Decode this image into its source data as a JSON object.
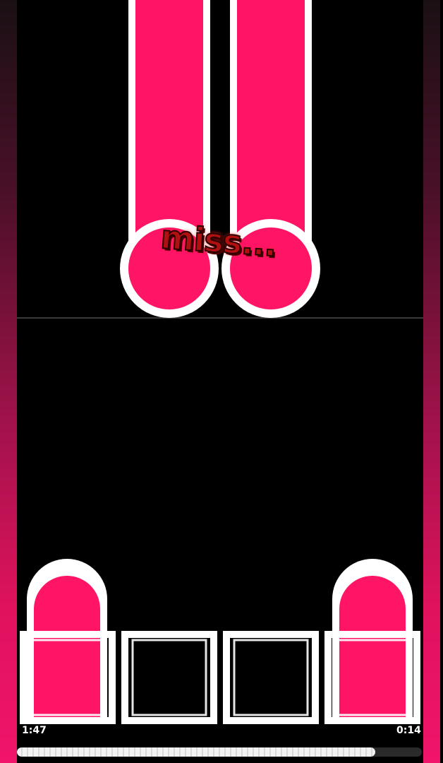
{
  "game": {
    "judgement": "miss...",
    "time_elapsed": "1:47",
    "time_remaining": "0:14",
    "progress": 0.885,
    "lanes": 4,
    "active_lanes": [
      true,
      false,
      false,
      true
    ]
  },
  "colors": {
    "note": "#ff1466",
    "note_outline": "#ffffff",
    "background": "#000000",
    "judgement_miss": "#b01010",
    "side_gradient_top": "#1a1014",
    "side_gradient_bottom": "#f0146a"
  },
  "icons": {
    "hold_note": "hold-note-shape",
    "receptor": "square-receptor"
  }
}
